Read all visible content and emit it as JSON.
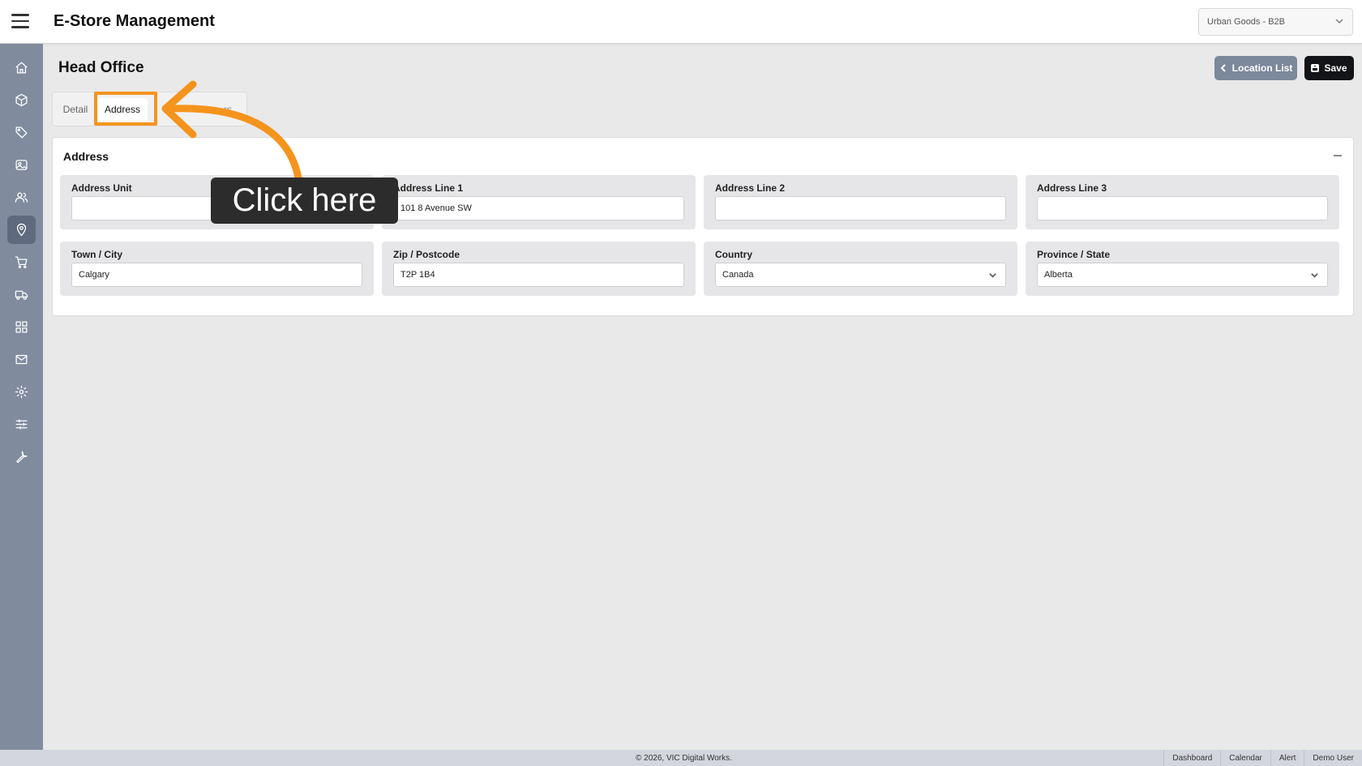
{
  "header": {
    "app_title": "E-Store Management",
    "store_selector_value": "Urban Goods - B2B"
  },
  "sidebar": {
    "items": [
      {
        "icon": "home-icon"
      },
      {
        "icon": "box-icon"
      },
      {
        "icon": "tag-icon"
      },
      {
        "icon": "image-icon"
      },
      {
        "icon": "users-icon"
      },
      {
        "icon": "location-pin-icon",
        "active": true
      },
      {
        "icon": "cart-icon"
      },
      {
        "icon": "truck-icon"
      },
      {
        "icon": "grid-icon"
      },
      {
        "icon": "mail-icon"
      },
      {
        "icon": "gear-icon"
      },
      {
        "icon": "sliders-icon"
      },
      {
        "icon": "wrench-icon"
      }
    ]
  },
  "page": {
    "title": "Head Office",
    "location_list_label": "Location List",
    "save_label": "Save"
  },
  "tabs": {
    "detail": "Detail",
    "address": "Address",
    "third": "...rs"
  },
  "address_card": {
    "title": "Address",
    "fields": {
      "address_unit": {
        "label": "Address Unit",
        "value": ""
      },
      "address_line_1": {
        "label": "Address Line 1",
        "value": "101 8 Avenue SW"
      },
      "address_line_2": {
        "label": "Address Line 2",
        "value": ""
      },
      "address_line_3": {
        "label": "Address Line 3",
        "value": ""
      },
      "town_city": {
        "label": "Town / City",
        "value": "Calgary"
      },
      "zip_postcode": {
        "label": "Zip / Postcode",
        "value": "T2P 1B4"
      },
      "country": {
        "label": "Country",
        "value": "Canada"
      },
      "province_state": {
        "label": "Province / State",
        "value": "Alberta"
      }
    }
  },
  "annotation": {
    "callout_text": "Click here",
    "highlight_color": "#f5941d"
  },
  "footer": {
    "copyright": "© 2026, VIC Digital Works.",
    "links": [
      "Dashboard",
      "Calendar",
      "Alert",
      "Demo User"
    ]
  }
}
